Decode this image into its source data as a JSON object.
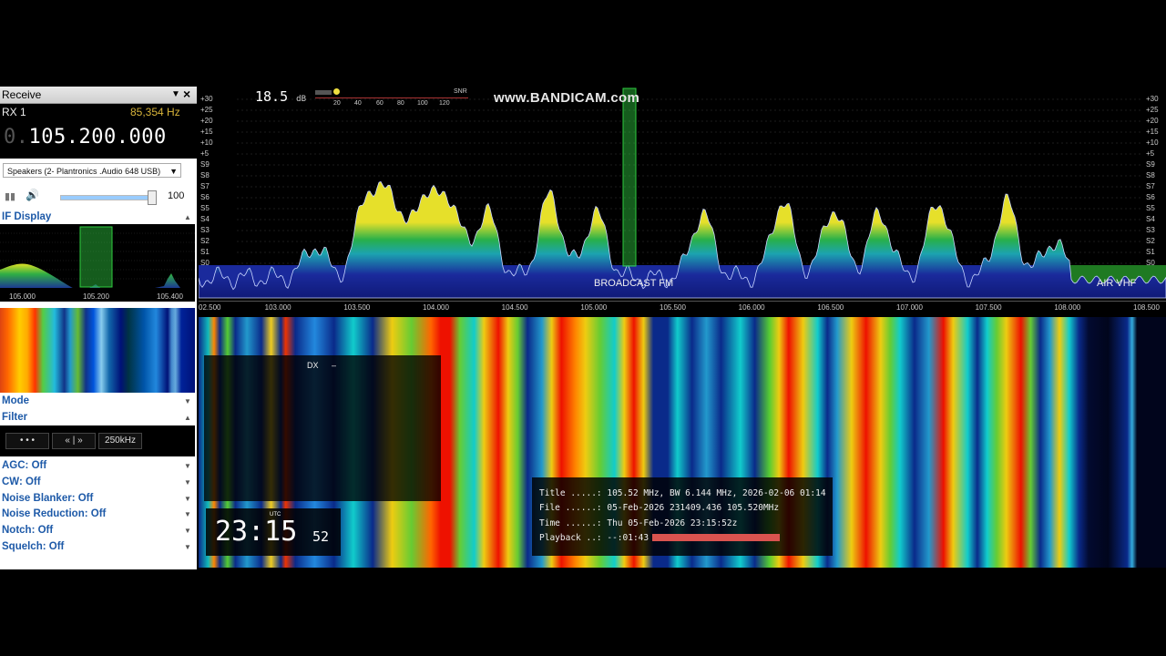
{
  "receive_panel": {
    "title": "Receive",
    "rx_id": "RX 1",
    "offset": "85,354 Hz",
    "freq_prefix": "0.",
    "freq_main": "105.200.000",
    "audio_device": "Speakers (2- Plantronics .Audio 648 USB)",
    "volume": "100",
    "volume_level": 0.95
  },
  "if_display": {
    "label": "IF Display",
    "ticks": [
      "105.000",
      "105.200",
      "105.400"
    ]
  },
  "mode": {
    "label": "Mode"
  },
  "filter": {
    "label": "Filter",
    "buttons": [
      "• • •",
      "« | »",
      "250kHz"
    ]
  },
  "controls": [
    "AGC: Off",
    "CW: Off",
    "Noise Blanker: Off",
    "Noise Reduction: Off",
    "Notch: Off",
    "Squelch: Off"
  ],
  "spectrum": {
    "snr_value": "18.5",
    "snr_unit": "dB",
    "snr_label": "SNR",
    "snr_scale": [
      "20",
      "40",
      "60",
      "80",
      "100",
      "120"
    ],
    "watermark": "www.BANDICAM.com",
    "db_labels": [
      "+30",
      "+25",
      "+20",
      "+15",
      "+10",
      "+5",
      "S9",
      "S8",
      "S7",
      "S6",
      "S5",
      "S4",
      "S3",
      "S2",
      "S1",
      "S0"
    ],
    "freq_labels": [
      "02.500",
      "103.000",
      "103.500",
      "104.000",
      "104.500",
      "105.000",
      "105.500",
      "106.000",
      "106.500",
      "107.000",
      "107.500",
      "108.000",
      "108.500"
    ],
    "band_broadcast": "BROADCAST FM",
    "band_air": "AIR VHF",
    "colors": {
      "band_blue": "#1a2a9c",
      "band_green": "#1f7a22",
      "tuned": "#2ecc40"
    }
  },
  "overlay": {
    "dx_label": "DX",
    "dx_value": "–",
    "clock_hm": "23:15",
    "clock_sec": "52",
    "clock_tz": "UTC",
    "info_title": "Title .....: 105.52 MHz, BW 6.144 MHz, 2026-02-06 01:14",
    "info_file": "File ......: 05-Feb-2026 231409.436 105.520MHz",
    "info_time": "Time ......: Thu 05-Feb-2026 23:15:52z",
    "info_playback": "Playback ..: --:01:43"
  }
}
